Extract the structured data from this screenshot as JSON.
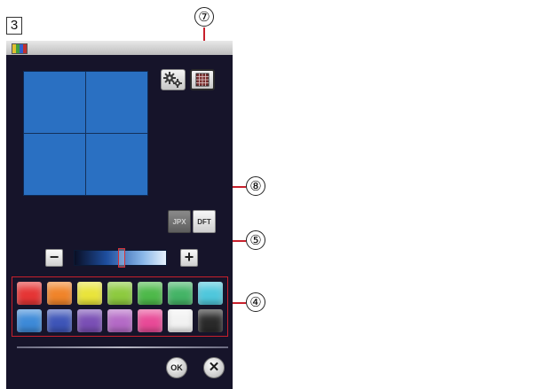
{
  "figure_step": "3",
  "callouts": {
    "grid_button": "⑦",
    "jpx_button": "⑧",
    "slider": "⑤",
    "palette": "④"
  },
  "toolbar": {
    "settings_icon": "gear-icon",
    "grid_icon": "grid-icon"
  },
  "buttons": {
    "jpx": "JPX",
    "dft": "DFT",
    "minus": "−",
    "plus": "+",
    "ok": "OK",
    "cancel": "✕"
  },
  "slider": {
    "level": 0.5
  },
  "palette": {
    "row1": [
      "#e53535",
      "#f0842a",
      "#e9e43b",
      "#8dca3f",
      "#4eb94a",
      "#44b466",
      "#4fc7dc"
    ],
    "row2": [
      "#3d8ad8",
      "#3e55b8",
      "#7a4fb5",
      "#b46ac6",
      "#e84a97",
      "#f2f2f2",
      "#2a2a2a"
    ]
  },
  "colors": {
    "preview_fill": "#2a70c2",
    "callout_line": "#c8202c",
    "screen_background": "#16142a"
  }
}
